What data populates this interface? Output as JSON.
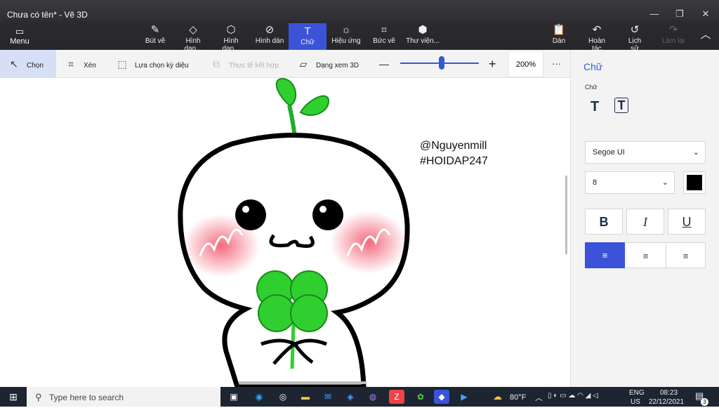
{
  "window": {
    "title": "Chưa có tên* - Vẽ 3D"
  },
  "ribbon": {
    "menu": "Menu",
    "items": [
      "Bút vẽ",
      "Hình dạn...",
      "Hình dạn...",
      "Hình dán",
      "Chữ",
      "Hiệu ứng",
      "Bức vẽ",
      "Thư viện..."
    ],
    "right": [
      "Dán",
      "Hoàn tác",
      "Lịch sử",
      "Làm lại"
    ]
  },
  "toolbar": {
    "select": "Chọn",
    "crop": "Xén",
    "magic_select": "Lựa chọn kỳ diệu",
    "mixed_reality": "Thực tế kết hợp",
    "view_3d": "Dạng xem 3D",
    "zoom_value": "200%",
    "zoom_percent": 0.53,
    "more": "···"
  },
  "canvas": {
    "text_line1": "@Nguyenmill",
    "text_line2": "#HOIDAP247"
  },
  "side": {
    "header": "Chữ",
    "sub": "Chữ",
    "font": "Segoe UI",
    "size": "8",
    "color": "#000000",
    "bold": "B",
    "italic": "I",
    "underline": "U"
  },
  "taskbar": {
    "search": "Type here to search",
    "temp": "80°F",
    "lang1": "ENG",
    "lang2": "US",
    "time": "08:23",
    "date": "22/12/2021",
    "notif": "3"
  }
}
